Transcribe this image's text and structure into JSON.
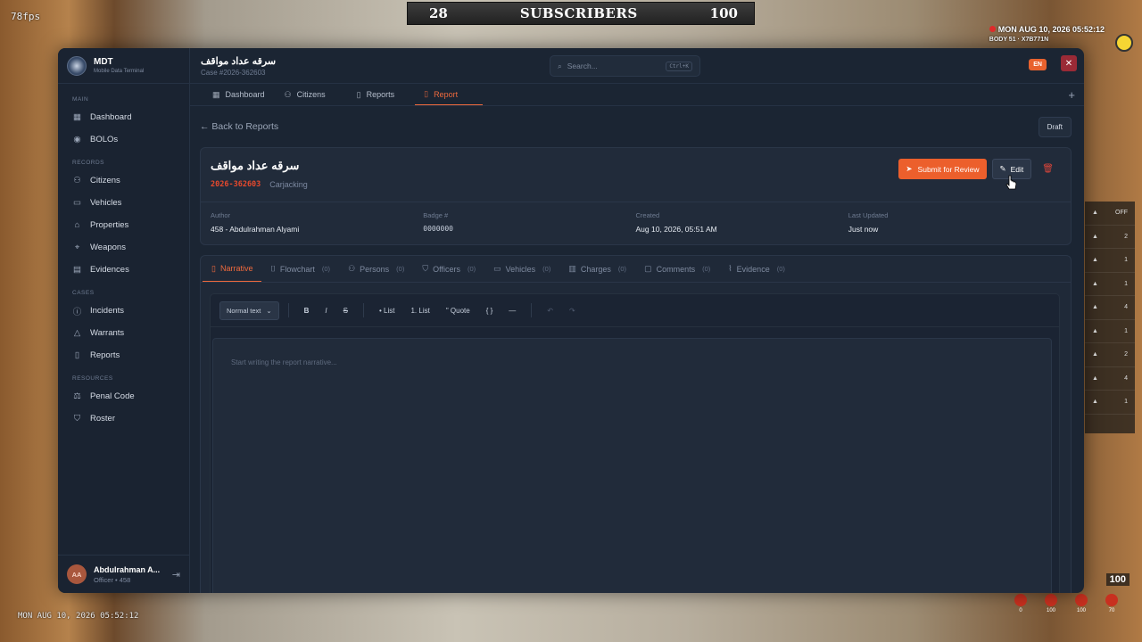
{
  "hud": {
    "fps": "78fps",
    "subs_left": "28",
    "subs_title": "SUBSCRIBERS",
    "subs_right": "100",
    "clock": "MON AUG 10, 2026 05:52:12",
    "clock_sub": "BODY 51 · X7B771N",
    "bottom_time": "MON AUG 10, 2026 05:52:12",
    "health": "100",
    "side_rows": [
      "OFF",
      "2",
      "1",
      "1",
      "4",
      "1",
      "2",
      "4",
      "1"
    ],
    "stats": [
      "0",
      "100",
      "100",
      "70"
    ]
  },
  "app": {
    "title": "MDT",
    "subtitle": "Mobile Data Terminal",
    "case_title": "سرقه عداد مواقف",
    "case_number": "Case #2026-362603",
    "search_placeholder": "Search...",
    "search_shortcut": "Ctrl+K",
    "lang": "EN",
    "close": "✕"
  },
  "sidebar": {
    "sections": {
      "main": "MAIN",
      "records": "RECORDS",
      "cases": "CASES",
      "resources": "RESOURCES"
    },
    "items": [
      {
        "label": "Dashboard",
        "icon": "grid-icon"
      },
      {
        "label": "BOLOs",
        "icon": "eye-icon"
      },
      {
        "label": "Citizens",
        "icon": "users-icon"
      },
      {
        "label": "Vehicles",
        "icon": "car-icon"
      },
      {
        "label": "Properties",
        "icon": "building-icon"
      },
      {
        "label": "Weapons",
        "icon": "weapon-icon"
      },
      {
        "label": "Evidences",
        "icon": "archive-icon"
      },
      {
        "label": "Incidents",
        "icon": "alert-circle-icon"
      },
      {
        "label": "Warrants",
        "icon": "warning-icon"
      },
      {
        "label": "Reports",
        "icon": "document-icon"
      },
      {
        "label": "Penal Code",
        "icon": "book-icon"
      },
      {
        "label": "Roster",
        "icon": "shield-icon"
      }
    ],
    "user": {
      "initials": "AA",
      "name": "Abdulrahman A...",
      "role": "Officer • 458"
    }
  },
  "tabs": [
    {
      "label": "Dashboard",
      "icon": "grid-icon"
    },
    {
      "label": "Citizens",
      "icon": "user-icon"
    },
    {
      "label": "Reports",
      "icon": "document-icon"
    },
    {
      "label": "Report",
      "icon": "document-icon",
      "active": true
    }
  ],
  "content": {
    "back": "← Back to Reports",
    "status": "Draft",
    "report_title": "سرقه عداد مواقف",
    "report_case": "2026-362603",
    "report_type": "Carjacking",
    "submit": "Submit for Review",
    "edit": "Edit",
    "fields": [
      {
        "label": "Author",
        "value": "458 - Abdulrahman Alyami"
      },
      {
        "label": "Badge #",
        "value": "0000000"
      },
      {
        "label": "Created",
        "value": "Aug 10, 2026, 05:51 AM"
      },
      {
        "label": "Last Updated",
        "value": "Just now"
      }
    ],
    "subtabs": [
      {
        "label": "Narrative",
        "count": "",
        "active": true
      },
      {
        "label": "Flowchart",
        "count": "(0)"
      },
      {
        "label": "Persons",
        "count": "(0)"
      },
      {
        "label": "Officers",
        "count": "(0)"
      },
      {
        "label": "Vehicles",
        "count": "(0)"
      },
      {
        "label": "Charges",
        "count": "(0)"
      },
      {
        "label": "Comments",
        "count": "(0)"
      },
      {
        "label": "Evidence",
        "count": "(0)"
      }
    ],
    "toolbar": {
      "format": "Normal text",
      "bold": "B",
      "italic": "I",
      "strike": "S",
      "bullet": "• List",
      "numbered": "1. List",
      "quote": "\" Quote",
      "code": "{ }",
      "rule": "—",
      "undo": "↶",
      "redo": "↷"
    },
    "narrative_placeholder": "Start writing the report narrative..."
  },
  "colors": {
    "accent": "#ec5f2c",
    "background": "#1b2533",
    "danger": "#d8453a"
  }
}
